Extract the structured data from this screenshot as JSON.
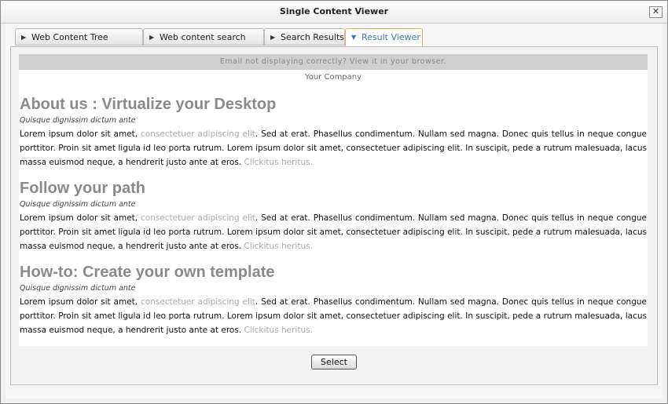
{
  "window": {
    "title": "Single Content Viewer",
    "close_label": "✕"
  },
  "tabs": [
    {
      "label": "Web Content Tree Selector",
      "icon": "triangle-right-icon",
      "active": false
    },
    {
      "label": "Web content search form",
      "icon": "triangle-right-icon",
      "active": false
    },
    {
      "label": "Search Results",
      "icon": "triangle-right-icon",
      "active": false
    },
    {
      "label": "Result Viewer",
      "icon": "triangle-down-icon",
      "active": true
    }
  ],
  "email": {
    "preview_notice": "Email not displaying correctly? View it in your browser.",
    "company": "Your Company",
    "sections": [
      {
        "title": "About us : Virtualize your Desktop",
        "subtitle": "Quisque dignissim dictum ante",
        "text_start": "Lorem ipsum dolor sit amet, ",
        "link1": "consectetuer adipiscing elit",
        "text_mid": ". Sed at erat. Phasellus condimentum. Nullam sed magna. Donec quis tellus in neque congue porttitor. Proin sit amet ligula id leo porta rutrum. Lorem ipsum dolor sit amet, consectetuer adipiscing elit. In suscipit, pede a rutrum malesuada, lacus massa euismod neque, a hendrerit justo ante at eros. ",
        "link2": "Clickitus heritus."
      },
      {
        "title": "Follow your path",
        "subtitle": "Quisque dignissim dictum ante",
        "text_start": "Lorem ipsum dolor sit amet, ",
        "link1": "consectetuer adipiscing elit",
        "text_mid": ". Sed at erat. Phasellus condimentum. Nullam sed magna. Donec quis tellus in neque congue porttitor. Proin sit amet ligula id leo porta rutrum. Lorem ipsum dolor sit amet, consectetuer adipiscing elit. In suscipit, pede a rutrum malesuada, lacus massa euismod neque, a hendrerit justo ante at eros. ",
        "link2": "Clickitus heritus."
      },
      {
        "title": "How-to: Create your own template",
        "subtitle": "Quisque dignissim dictum ante",
        "text_start": "Lorem ipsum dolor sit amet, ",
        "link1": "consectetuer adipiscing elit",
        "text_mid": ". Sed at erat. Phasellus condimentum. Nullam sed magna. Donec quis tellus in neque congue porttitor. Proin sit amet ligula id leo porta rutrum. Lorem ipsum dolor sit amet, consectetuer adipiscing elit. In suscipit, pede a rutrum malesuada, lacus massa euismod neque, a hendrerit justo ante at eros. ",
        "link2": "Clickitus heritus."
      }
    ]
  },
  "actions": {
    "select_label": "Select"
  },
  "colors": {
    "active_tab_border": "#e8b54f",
    "active_tab_text": "#3b74b8",
    "section_title": "#8a8a8a",
    "link": "#aaaaaa"
  }
}
